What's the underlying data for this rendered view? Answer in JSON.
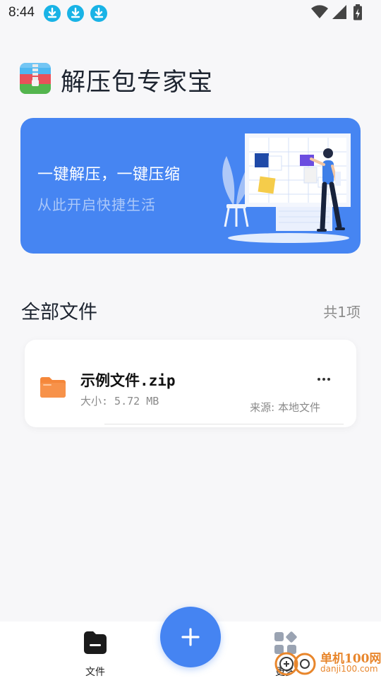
{
  "status_bar": {
    "time": "8:44",
    "notification_icons": [
      "download-icon",
      "download-icon",
      "download-icon"
    ],
    "system_icons": [
      "wifi-icon",
      "cell-signal-icon",
      "battery-charging-icon"
    ]
  },
  "header": {
    "app_title": "解压包专家宝",
    "logo_icon": "zip-archive-logo"
  },
  "banner": {
    "title": "一键解压，一键压缩",
    "subtitle": "从此开启快捷生活",
    "background_color": "#4685f2"
  },
  "files_section": {
    "heading": "全部文件",
    "count": "共1项",
    "files": [
      {
        "name": "示例文件.zip",
        "size": "大小: 5.72 MB",
        "source": "来源: 本地文件",
        "icon": "folder-icon",
        "icon_color": "#f5873a"
      }
    ]
  },
  "bottom_nav": {
    "files_label": "文件",
    "more_label": "更多",
    "fab_icon": "plus-icon",
    "accent_color": "#4584f2"
  },
  "watermark": {
    "cn": "单机100网",
    "en": "danji100.com"
  }
}
